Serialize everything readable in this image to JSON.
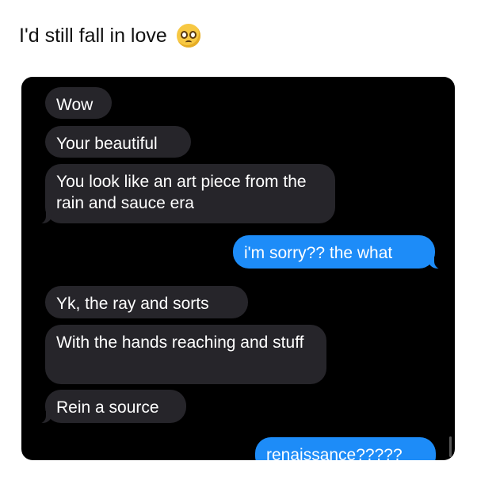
{
  "caption": {
    "text": "I'd still fall in love",
    "emoji": "pleading-face-emoji"
  },
  "conversation": {
    "messages": [
      {
        "sender": "them",
        "text": "Wow"
      },
      {
        "sender": "them",
        "text": "Your beautiful"
      },
      {
        "sender": "them",
        "text": "You look like an art piece from the rain and sauce era"
      },
      {
        "sender": "me",
        "text": "i'm sorry?? the what"
      },
      {
        "sender": "them",
        "text": "Yk, the ray and sorts"
      },
      {
        "sender": "them",
        "text": "With the hands reaching and stuff"
      },
      {
        "sender": "them",
        "text": "Rein a source"
      },
      {
        "sender": "me",
        "text": "renaissance?????"
      }
    ]
  },
  "colors": {
    "incoming_bubble": "#26252a",
    "outgoing_bubble": "#1d8cf8",
    "chat_background": "#000000"
  }
}
